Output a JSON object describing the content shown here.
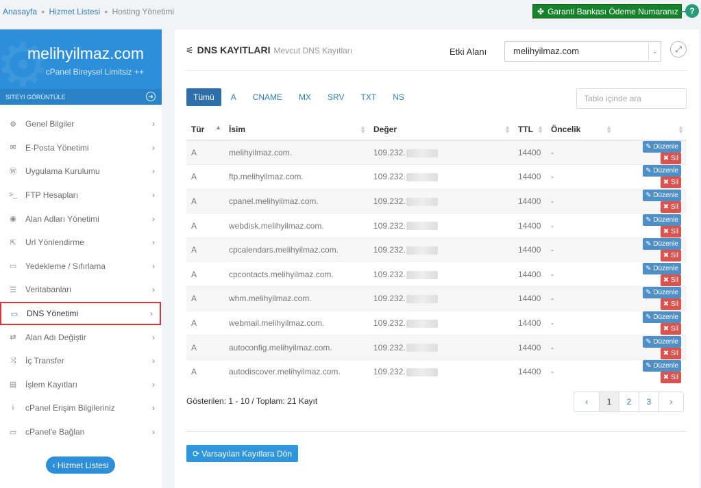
{
  "breadcrumb": {
    "home": "Anasayfa",
    "services": "Hizmet Listesi",
    "current": "Hosting Yönetimi"
  },
  "bank_button": {
    "label": "Garanti Bankası Ödeme Numaranız",
    "help": "?"
  },
  "sidebar": {
    "domain": "melihyilmaz.com",
    "plan": "cPanel Bireysel Limitsiz ++",
    "view_site": "SITEYI GÖRÜNTÜLE",
    "items": [
      {
        "label": "Genel Bilgiler",
        "icon": "gears-icon",
        "glyph": "⚙"
      },
      {
        "label": "E-Posta Yönetimi",
        "icon": "envelope-icon",
        "glyph": "✉"
      },
      {
        "label": "Uygulama Kurulumu",
        "icon": "wordpress-icon",
        "glyph": "Ⓦ"
      },
      {
        "label": "FTP Hesapları",
        "icon": "terminal-icon",
        "glyph": ">_"
      },
      {
        "label": "Alan Adları Yönetimi",
        "icon": "globe-icon",
        "glyph": "◉"
      },
      {
        "label": "Url Yönlendirme",
        "icon": "share-icon",
        "glyph": "⇱"
      },
      {
        "label": "Yedekleme / Sıfırlama",
        "icon": "hdd-icon",
        "glyph": "▭"
      },
      {
        "label": "Veritabanları",
        "icon": "database-icon",
        "glyph": "☰"
      },
      {
        "label": "DNS Yönetimi",
        "icon": "laptop-icon",
        "glyph": "▭"
      },
      {
        "label": "Alan Adı Değiştir",
        "icon": "retweet-icon",
        "glyph": "⇄"
      },
      {
        "label": "İç Transfer",
        "icon": "random-icon",
        "glyph": "⤨"
      },
      {
        "label": "İşlem Kayıtları",
        "icon": "list-icon",
        "glyph": "▤"
      },
      {
        "label": "cPanel Erişim Bilgileriniz",
        "icon": "info-icon",
        "glyph": "i"
      },
      {
        "label": "cPanel'e Bağlan",
        "icon": "desktop-icon",
        "glyph": "▭"
      }
    ],
    "active_item": "DNS Yönetimi",
    "service_list_button": "Hizmet Listesi"
  },
  "header": {
    "title": "DNS KAYITLARI",
    "subtitle": "Mevcut DNS Kayıtları",
    "domain_label": "Etki Alanı",
    "domain_value": "melihyilmaz.com"
  },
  "filters": [
    "Tümü",
    "A",
    "CNAME",
    "MX",
    "SRV",
    "TXT",
    "NS"
  ],
  "active_filter": "Tümü",
  "search": {
    "placeholder": "Tablo içinde ara"
  },
  "table": {
    "columns": [
      "Tür",
      "İsim",
      "Değer",
      "TTL",
      "Öncelik"
    ],
    "edit_label": "Düzenle",
    "delete_label": "Sil",
    "rows": [
      {
        "type": "A",
        "name": "melihyilmaz.com.",
        "value": "109.232.",
        "ttl": "14400",
        "priority": "-"
      },
      {
        "type": "A",
        "name": "ftp.melihyilmaz.com.",
        "value": "109.232.",
        "ttl": "14400",
        "priority": "-"
      },
      {
        "type": "A",
        "name": "cpanel.melihyilmaz.com.",
        "value": "109.232.",
        "ttl": "14400",
        "priority": "-"
      },
      {
        "type": "A",
        "name": "webdisk.melihyilmaz.com.",
        "value": "109.232.",
        "ttl": "14400",
        "priority": "-"
      },
      {
        "type": "A",
        "name": "cpcalendars.melihyilmaz.com.",
        "value": "109.232.",
        "ttl": "14400",
        "priority": "-"
      },
      {
        "type": "A",
        "name": "cpcontacts.melihyilmaz.com.",
        "value": "109.232.",
        "ttl": "14400",
        "priority": "-"
      },
      {
        "type": "A",
        "name": "whm.melihyilmaz.com.",
        "value": "109.232.",
        "ttl": "14400",
        "priority": "-"
      },
      {
        "type": "A",
        "name": "webmail.melihyilmaz.com.",
        "value": "109.232.",
        "ttl": "14400",
        "priority": "-"
      },
      {
        "type": "A",
        "name": "autoconfig.melihyilmaz.com.",
        "value": "109.232.",
        "ttl": "14400",
        "priority": "-"
      },
      {
        "type": "A",
        "name": "autodiscover.melihyilmaz.com.",
        "value": "109.232.",
        "ttl": "14400",
        "priority": "-"
      }
    ]
  },
  "summary": "Gösterilen: 1 - 10 / Toplam: 21 Kayıt",
  "pagination": {
    "prev": "‹",
    "pages": [
      "1",
      "2",
      "3"
    ],
    "current": "1",
    "next": "›"
  },
  "reset_button": "Varsayılan Kayıtlara Dön"
}
